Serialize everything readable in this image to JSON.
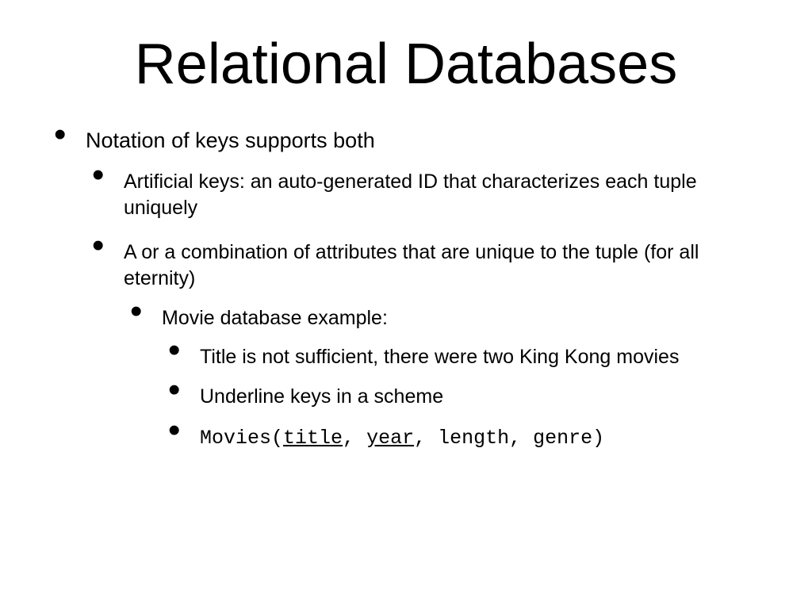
{
  "title": "Relational Databases",
  "bullets": {
    "l1": "Notation of keys supports both",
    "l2a": "Artificial keys:  an auto-generated ID that characterizes each tuple uniquely",
    "l2b": "A or a combination of attributes that are unique to the tuple (for all eternity)",
    "l3": "Movie database example:",
    "l4a": "Title is not sufficient, there were two King Kong movies",
    "l4b": "Underline keys in a scheme",
    "scheme": {
      "name": "Movies",
      "open": "(",
      "attr1": "title",
      "sep1": ", ",
      "attr2": "year",
      "sep2": ", ",
      "attr3": "length",
      "sep3": ", ",
      "attr4": "genre",
      "close": ")"
    }
  }
}
